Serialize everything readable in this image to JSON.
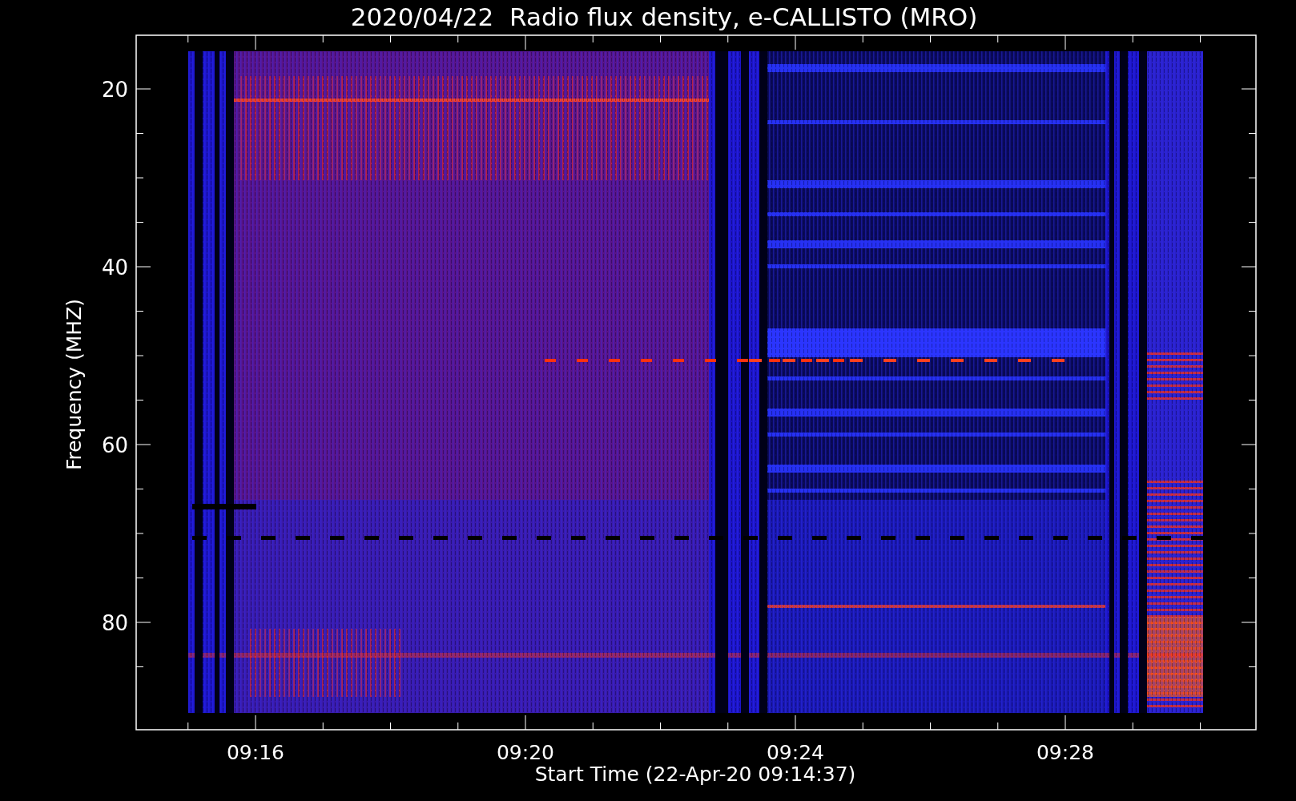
{
  "title": "2020/04/22  Radio flux density, e-CALLISTO (MRO)",
  "y_axis": {
    "label": "Frequency (MHZ)",
    "ticks": [
      "20",
      "40",
      "60",
      "80"
    ]
  },
  "x_axis": {
    "label": "Start Time (22-Apr-20 09:14:37)",
    "ticks": [
      "09:16",
      "09:20",
      "09:24",
      "09:28"
    ]
  }
}
